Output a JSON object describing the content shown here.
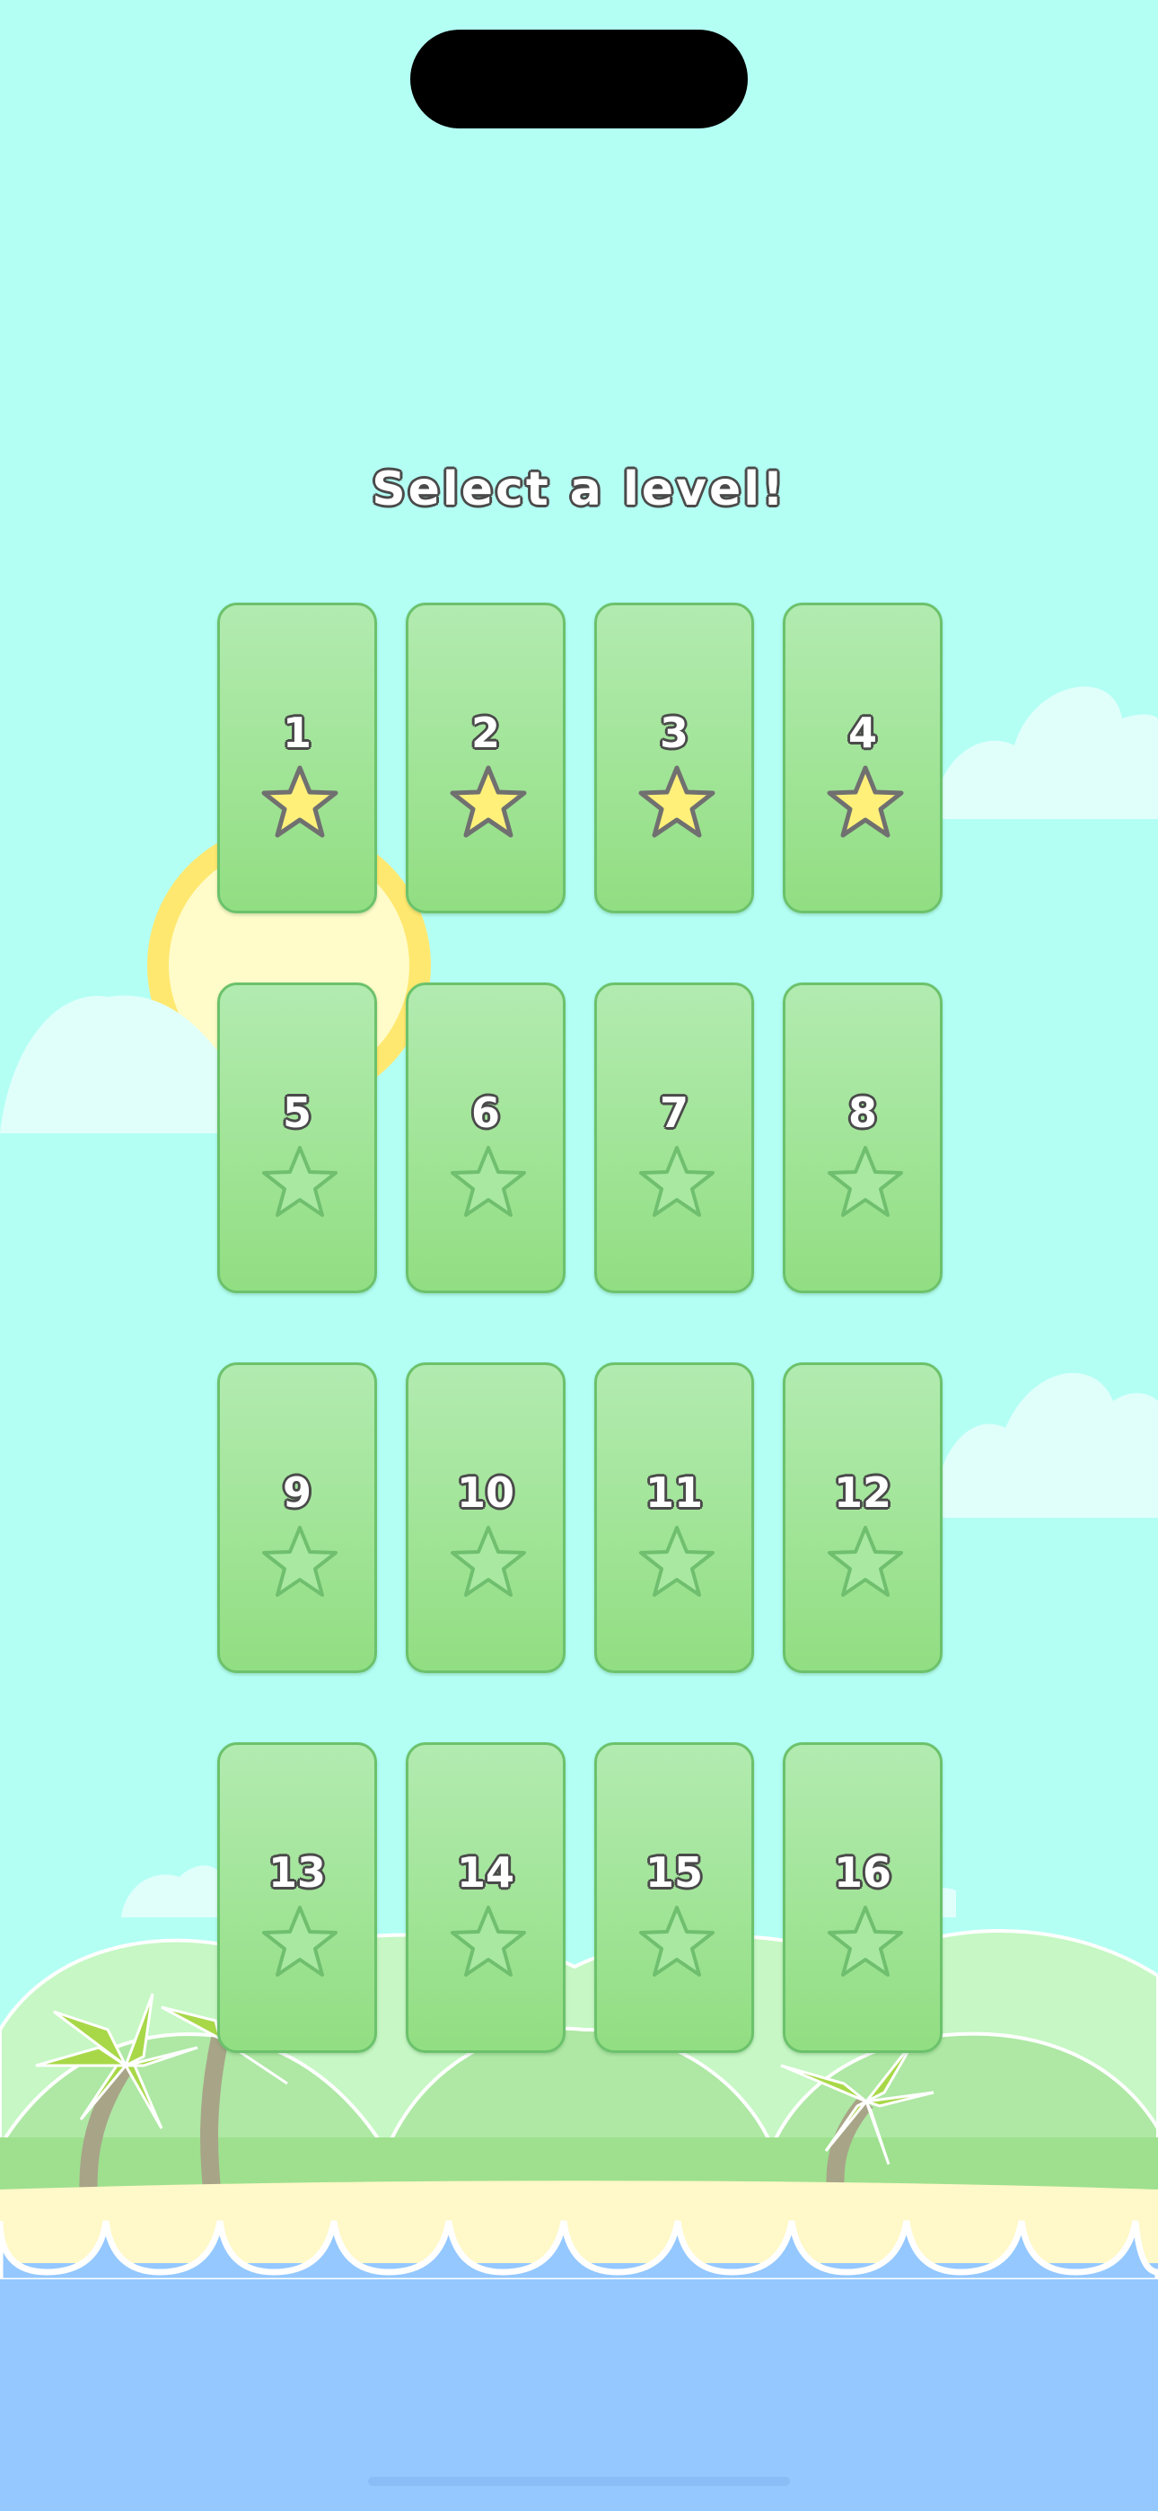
{
  "screen": {
    "title": "Select a level!",
    "colors": {
      "sky": "#b3fff4",
      "sea": "#94c8ff",
      "sand": "#fff8c8",
      "hills": "#a8e8a0",
      "tile_top": "#b2ebb0",
      "tile_bottom": "#92de82",
      "star_earned": "#fff07a",
      "star_empty": "#a8e8a0"
    }
  },
  "levels": [
    {
      "number": "1",
      "star": "earned"
    },
    {
      "number": "2",
      "star": "earned"
    },
    {
      "number": "3",
      "star": "earned"
    },
    {
      "number": "4",
      "star": "earned"
    },
    {
      "number": "5",
      "star": "empty"
    },
    {
      "number": "6",
      "star": "empty"
    },
    {
      "number": "7",
      "star": "empty"
    },
    {
      "number": "8",
      "star": "empty"
    },
    {
      "number": "9",
      "star": "empty"
    },
    {
      "number": "10",
      "star": "empty"
    },
    {
      "number": "11",
      "star": "empty"
    },
    {
      "number": "12",
      "star": "empty"
    },
    {
      "number": "13",
      "star": "empty"
    },
    {
      "number": "14",
      "star": "empty"
    },
    {
      "number": "15",
      "star": "empty"
    },
    {
      "number": "16",
      "star": "empty"
    }
  ]
}
